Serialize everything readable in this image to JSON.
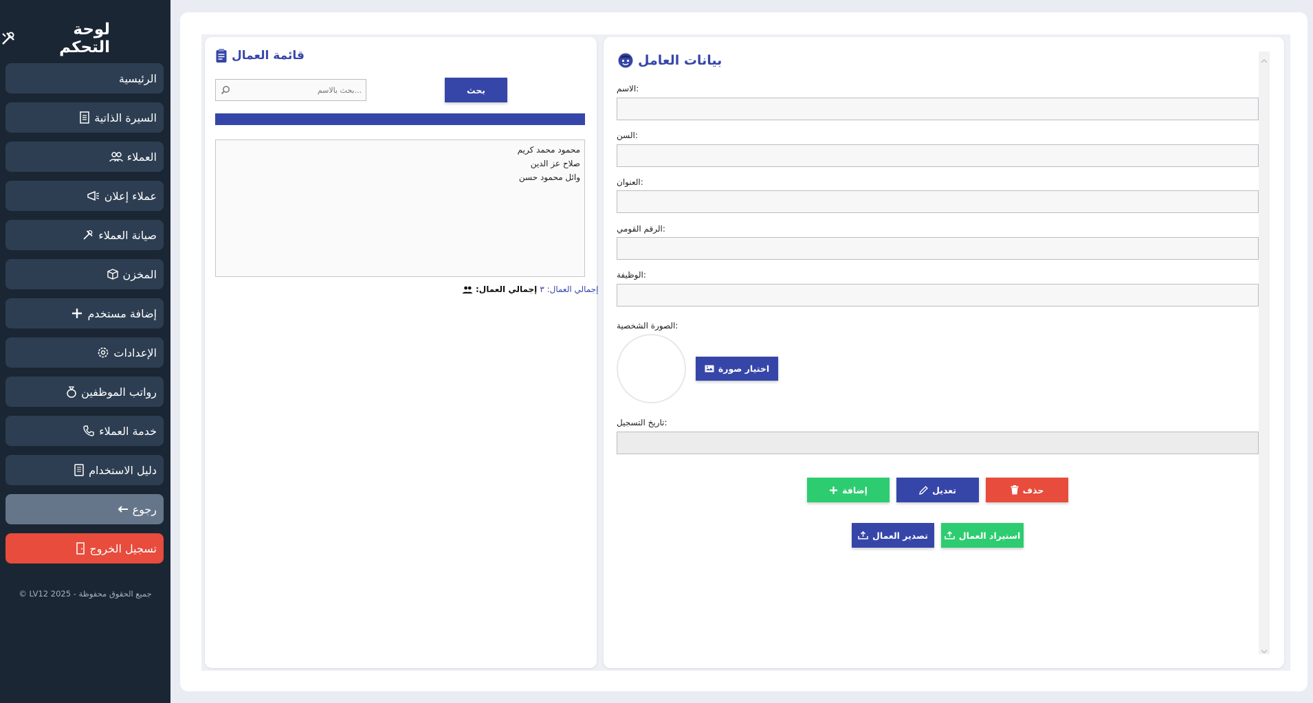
{
  "sidebar": {
    "title": "لوحة التحكم",
    "items": [
      {
        "label": "الرئيسية"
      },
      {
        "label": "السيرة الذاتية"
      },
      {
        "label": "العملاء"
      },
      {
        "label": "عملاء إعلان"
      },
      {
        "label": "صيانة العملاء"
      },
      {
        "label": "المخزن"
      },
      {
        "label": "إضافة مستخدم"
      },
      {
        "label": "الإعدادات"
      },
      {
        "label": "رواتب الموظفين"
      },
      {
        "label": "خدمة العملاء"
      },
      {
        "label": "دليل الاستخدام"
      },
      {
        "label": "رجوع"
      },
      {
        "label": "تسجيل الخروج"
      }
    ],
    "footer": "جميع الحقوق محفوظة - LV12 2025 ©"
  },
  "workers_list": {
    "title": "قائمة العمال",
    "search_placeholder": "...بحث بالاسم",
    "search_button": "بحث",
    "workers": [
      "محمود محمد كريم",
      "صلاح عز الدين",
      "وائل محمود حسن"
    ],
    "total_label": "إجمالي العمال:",
    "total_value": "إجمالي العمال: ٣"
  },
  "worker_form": {
    "title": "بيانات العامل",
    "fields": {
      "name": ":الاسم",
      "age": ":السن",
      "address": ":العنوان",
      "national_id": ":الرقم القومي",
      "job": ":الوظيفة",
      "photo": ":الصورة الشخصية",
      "reg_date": ":تاريخ التسجيل"
    },
    "choose_photo": "اختيار صورة",
    "buttons": {
      "delete": "حذف",
      "edit": "تعديل",
      "add": "إضافة",
      "import": "استيراد العمال",
      "export": "تصدير العمال"
    }
  },
  "colors": {
    "sidebar_bg": "#1b2634",
    "nav_item": "#2e3e52",
    "accent_blue": "#3646a8",
    "green": "#2ecc71",
    "red": "#e74c3c"
  }
}
